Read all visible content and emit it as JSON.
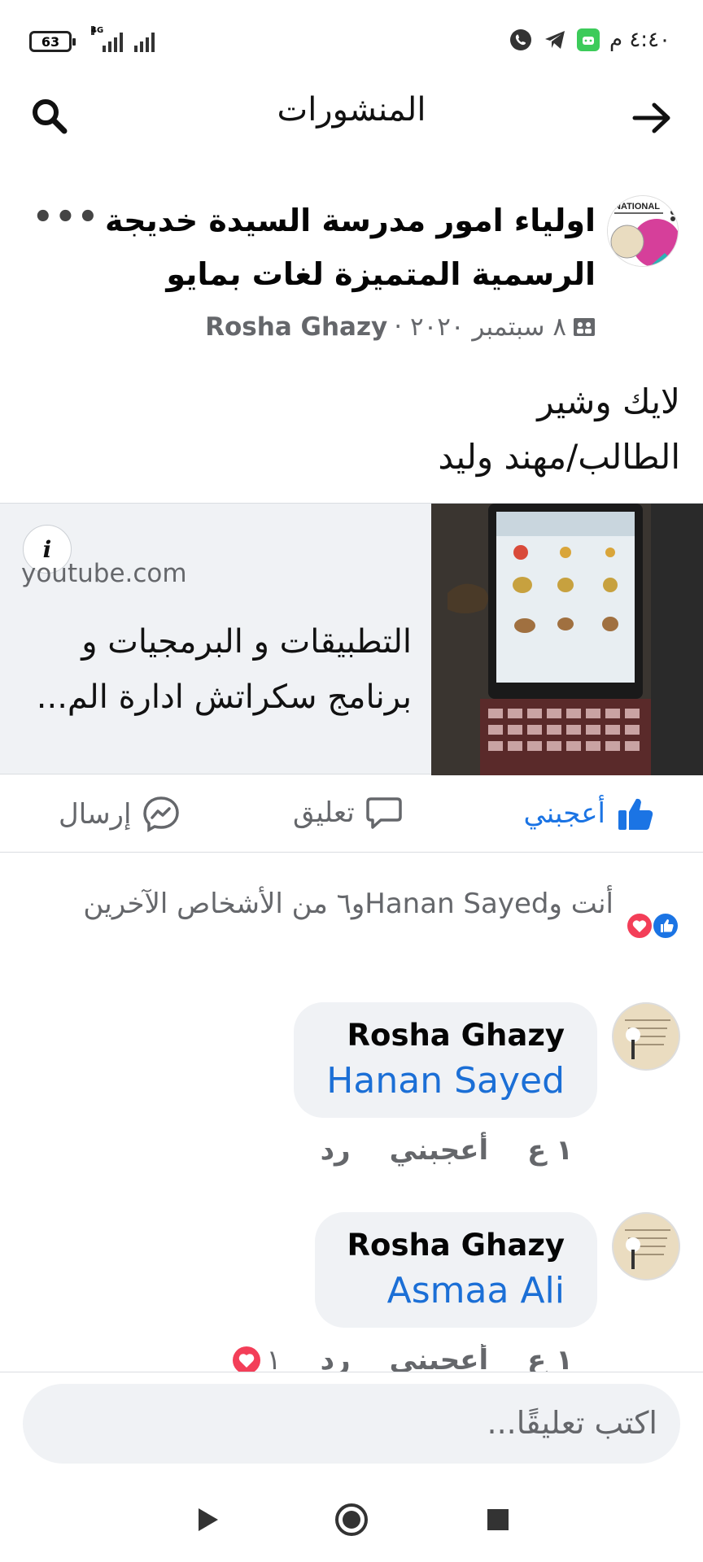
{
  "status_bar": {
    "time": "٤:٤٠ م",
    "battery": "63",
    "network": "4G"
  },
  "header": {
    "title": "المنشورات"
  },
  "post": {
    "author": "اولياء امور مدرسة السيدة خديجة الرسمية المتميزة لغات بمايو",
    "more": "•••",
    "date": "٨ سبتمبر ٢٠٢٠ ·",
    "poster": "Rosha Ghazy",
    "separator": "·",
    "text_line_1": "لايك وشير",
    "text_line_2": "الطالب/مهند وليد",
    "avatar_badge": "NATIONAL"
  },
  "link_card": {
    "domain": "youtube.com",
    "title": "التطبيقات و البرمجيات و برنامج سكراتش ادارة الم...",
    "info": "i"
  },
  "actions": {
    "like": "أعجبني",
    "comment": "تعليق",
    "send": "إرسال"
  },
  "reactions": {
    "summary": "أنت وHanan Sayedو٦ من الأشخاص الآخرين"
  },
  "comments": [
    {
      "name": "Rosha Ghazy",
      "mention": "Hanan Sayed",
      "time": "١ ع",
      "like": "أعجبني",
      "reply": "رد"
    },
    {
      "name": "Rosha Ghazy",
      "mention": "Asmaa Ali",
      "time": "١ ع",
      "like": "أعجبني",
      "reply": "رد",
      "reaction_count": "١"
    }
  ],
  "composer": {
    "placeholder": "اكتب تعليقًا..."
  },
  "colors": {
    "facebook_blue": "#1b74e4",
    "mention_blue": "#1b6fd6",
    "love_red": "#f33e58",
    "secondary_text": "#65676b"
  }
}
